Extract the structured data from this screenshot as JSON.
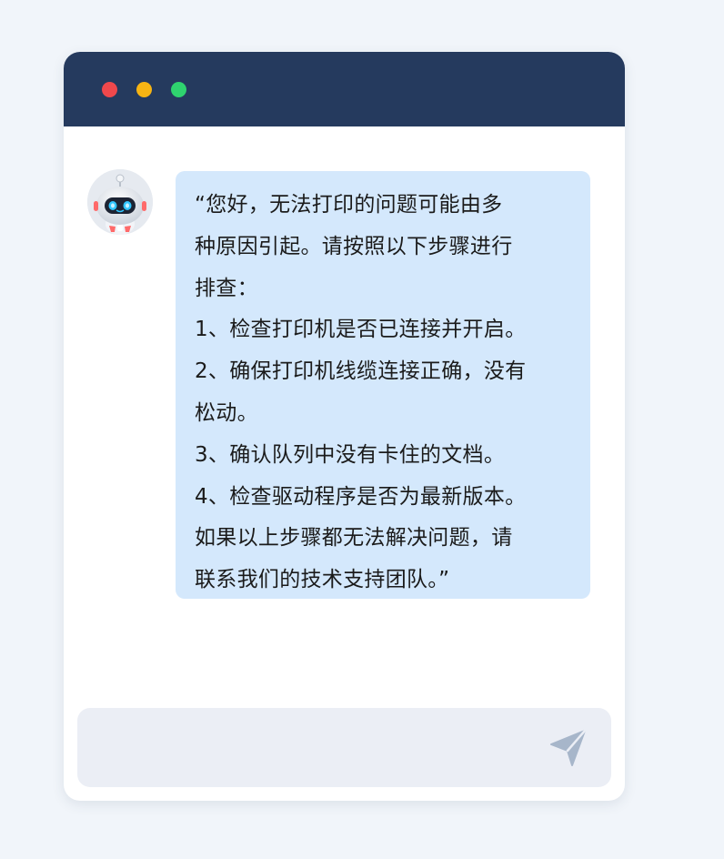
{
  "window": {
    "controls": [
      "close",
      "minimize",
      "maximize"
    ],
    "control_colors": {
      "close": "#f0484c",
      "minimize": "#f7b413",
      "maximize": "#2fd36f"
    },
    "titlebar_color": "#253a5e"
  },
  "chat": {
    "bot_avatar_icon": "robot-avatar-icon",
    "bubble_color": "#d4e8fc",
    "message_lines": [
      "“您好，无法打印的问题可能由多",
      "种原因引起。请按照以下步骤进行",
      "排查：",
      "1、检查打印机是否已连接并开启。",
      "2、确保打印机线缆连接正确，没有",
      "松动。",
      "3、确认队列中没有卡住的文档。",
      "4、检查驱动程序是否为最新版本。",
      "如果以上步骤都无法解决问题，请",
      "联系我们的技术支持团队。”"
    ]
  },
  "composer": {
    "send_icon": "send-icon",
    "input_value": ""
  }
}
